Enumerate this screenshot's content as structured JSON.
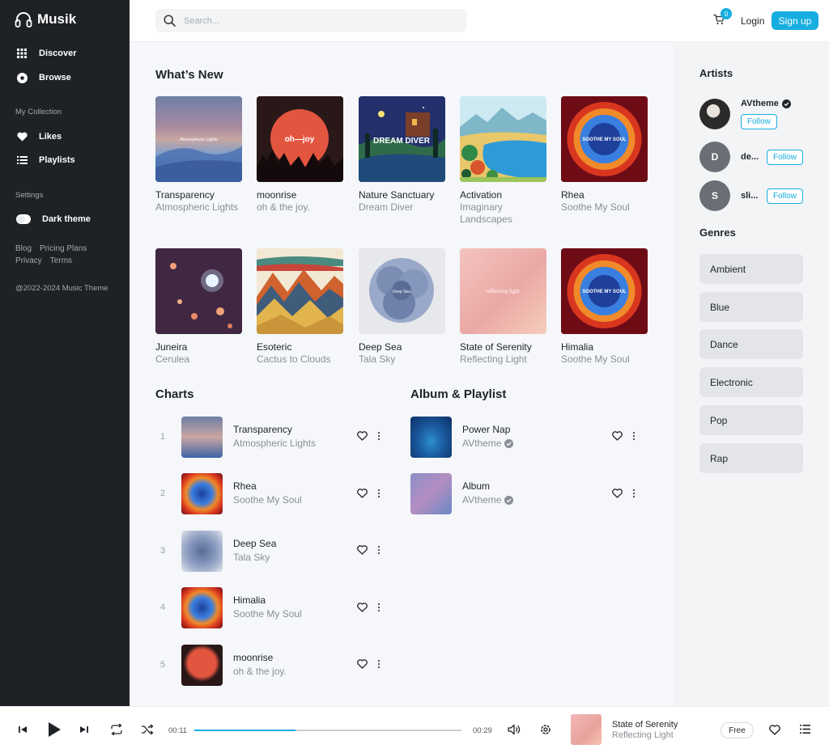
{
  "app": {
    "name": "Musik"
  },
  "colors": {
    "accent": "#16aee0",
    "sidebar": "#1e2125",
    "main_bg": "#f5f7fa"
  },
  "sidebar": {
    "nav": [
      {
        "label": "Discover",
        "icon": "grid-icon"
      },
      {
        "label": "Browse",
        "icon": "disc-icon"
      }
    ],
    "collection_heading": "My Collection",
    "collection": [
      {
        "label": "Likes",
        "icon": "heart-icon"
      },
      {
        "label": "Playlists",
        "icon": "list-icon"
      }
    ],
    "settings_heading": "Settings",
    "dark_theme_label": "Dark theme",
    "links": [
      "Blog",
      "Pricing Plans",
      "Privacy",
      "Terms"
    ],
    "copyright": "@2022-2024 Music Theme"
  },
  "header": {
    "search_placeholder": "Search...",
    "cart_count": "0",
    "login_label": "Login",
    "signup_label": "Sign up"
  },
  "whats_new": {
    "title": "What’s New",
    "items": [
      {
        "title": "Transparency",
        "artist": "Atmospheric Lights"
      },
      {
        "title": "moonrise",
        "artist": "oh & the joy."
      },
      {
        "title": "Nature Sanctuary",
        "artist": "Dream Diver"
      },
      {
        "title": "Activation",
        "artist": "Imaginary Landscapes"
      },
      {
        "title": "Rhea",
        "artist": "Soothe My Soul"
      },
      {
        "title": "Juneira",
        "artist": "Cerulea"
      },
      {
        "title": "Esoteric",
        "artist": "Cactus to Clouds"
      },
      {
        "title": "Deep Sea",
        "artist": "Tala Sky"
      },
      {
        "title": "State of Serenity",
        "artist": "Reflecting Light"
      },
      {
        "title": "Himalia",
        "artist": "Soothe My Soul"
      }
    ],
    "cover_text": {
      "transparency": "Atmospheric Lights",
      "moonrise": "oh—joy",
      "nature": "DREAM DIVER",
      "rhea": "SOOTHE MY SOUL",
      "deepsea": "Deep Sea",
      "serenity": "reflecting light",
      "himalia": "SOOTHE MY SOUL"
    }
  },
  "charts": {
    "title": "Charts",
    "items": [
      {
        "rank": "1",
        "title": "Transparency",
        "artist": "Atmospheric Lights"
      },
      {
        "rank": "2",
        "title": "Rhea",
        "artist": "Soothe My Soul"
      },
      {
        "rank": "3",
        "title": "Deep Sea",
        "artist": "Tala Sky"
      },
      {
        "rank": "4",
        "title": "Himalia",
        "artist": "Soothe My Soul"
      },
      {
        "rank": "5",
        "title": "moonrise",
        "artist": "oh & the joy."
      }
    ]
  },
  "album_playlist": {
    "title": "Album & Playlist",
    "items": [
      {
        "title": "Power Nap",
        "artist": "AVtheme"
      },
      {
        "title": "Album",
        "artist": "AVtheme"
      }
    ]
  },
  "artists": {
    "title": "Artists",
    "items": [
      {
        "name": "AVtheme",
        "initial": "",
        "follow": "Follow"
      },
      {
        "name": "de...",
        "initial": "D",
        "follow": "Follow"
      },
      {
        "name": "sli...",
        "initial": "S",
        "follow": "Follow"
      }
    ]
  },
  "genres": {
    "title": "Genres",
    "items": [
      "Ambient",
      "Blue",
      "Dance",
      "Electronic",
      "Pop",
      "Rap"
    ]
  },
  "player": {
    "current_time": "00:11",
    "duration": "00:29",
    "progress": 0.38,
    "title": "State of Serenity",
    "artist": "Reflecting Light",
    "plan": "Free"
  }
}
